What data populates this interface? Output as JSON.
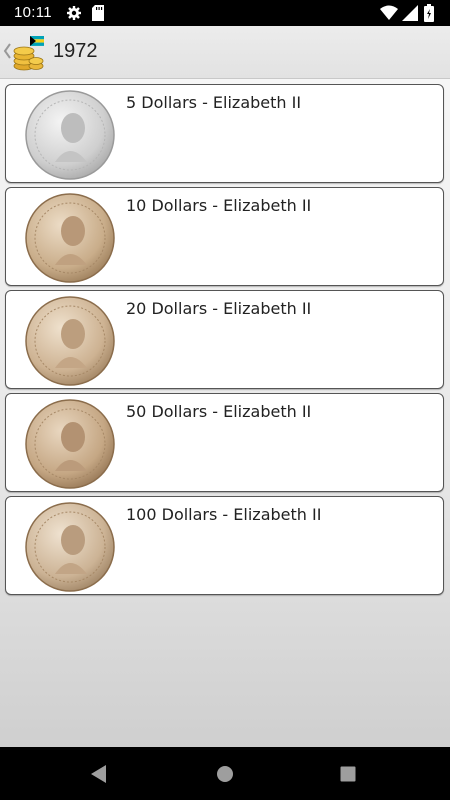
{
  "status_bar": {
    "time": "10:11",
    "icons": [
      "gear-icon",
      "sd-card-icon",
      "wifi-icon",
      "signal-icon",
      "battery-icon"
    ]
  },
  "app_bar": {
    "title": "1972",
    "back_icon": "chevron-left-icon",
    "logo_icon": "bahamas-flag-coins-logo"
  },
  "coins": [
    {
      "title": "5 Dollars - Elizabeth II",
      "metal": "silver"
    },
    {
      "title": "10 Dollars - Elizabeth II",
      "metal": "gold"
    },
    {
      "title": "20 Dollars - Elizabeth II",
      "metal": "gold"
    },
    {
      "title": "50 Dollars - Elizabeth II",
      "metal": "gold"
    },
    {
      "title": "100 Dollars - Elizabeth II",
      "metal": "gold"
    }
  ],
  "nav_bar": {
    "icons": [
      "back-triangle-icon",
      "home-circle-icon",
      "recents-square-icon"
    ]
  },
  "colors": {
    "status_bar": "#000000",
    "app_bar": "#e6e6e6",
    "card_border": "#555555",
    "silver_coin": "#d9d9d9",
    "gold_coin": "#c9ad8a"
  }
}
